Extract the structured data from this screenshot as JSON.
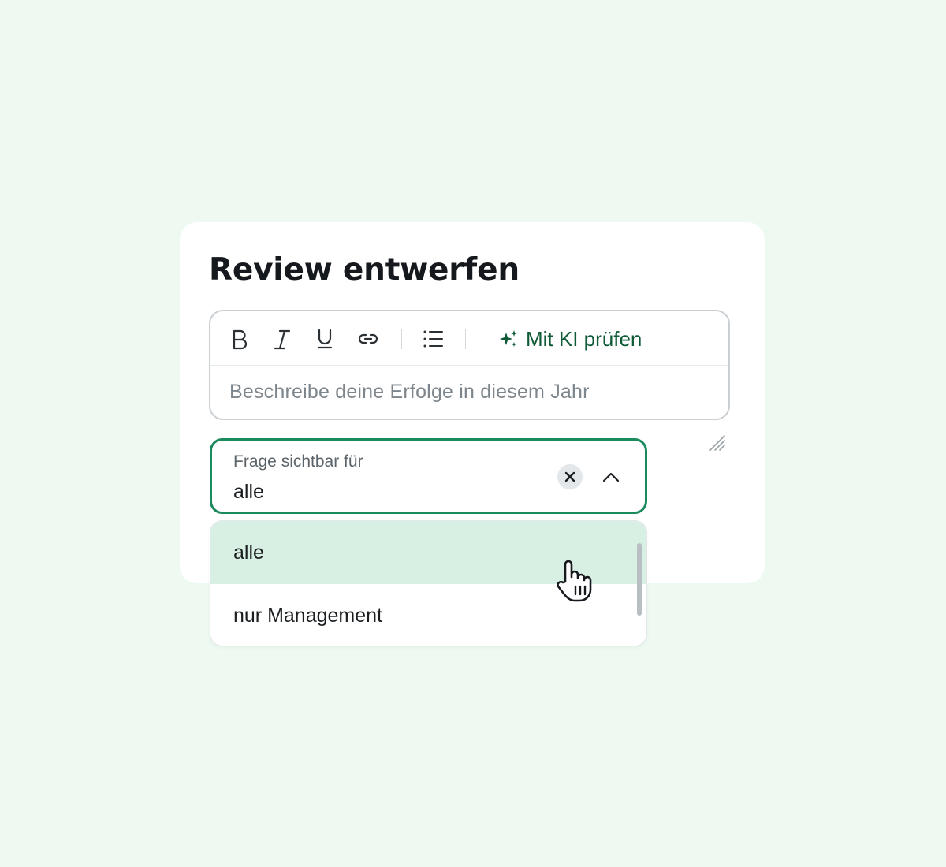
{
  "card": {
    "title": "Review entwerfen"
  },
  "editor": {
    "toolbar": {
      "bold_icon": "bold-icon",
      "italic_icon": "italic-icon",
      "underline_icon": "underline-icon",
      "link_icon": "link-icon",
      "list_icon": "bulleted-list-icon",
      "ai_button_label": "Mit KI prüfen",
      "ai_icon": "sparkle-icon"
    },
    "placeholder": "Beschreibe deine Erfolge in diesem Jahr"
  },
  "visibility_select": {
    "label": "Frage sichtbar für",
    "value": "alle",
    "clear_icon": "close-icon",
    "toggle_icon": "chevron-up-icon",
    "options": [
      {
        "label": "alle",
        "selected": true
      },
      {
        "label": "nur Management",
        "selected": false
      }
    ]
  },
  "colors": {
    "background": "#edf9f1",
    "accent": "#1b8a5d",
    "ai_text": "#0e5a36",
    "selected_option": "#d8f0e3"
  }
}
